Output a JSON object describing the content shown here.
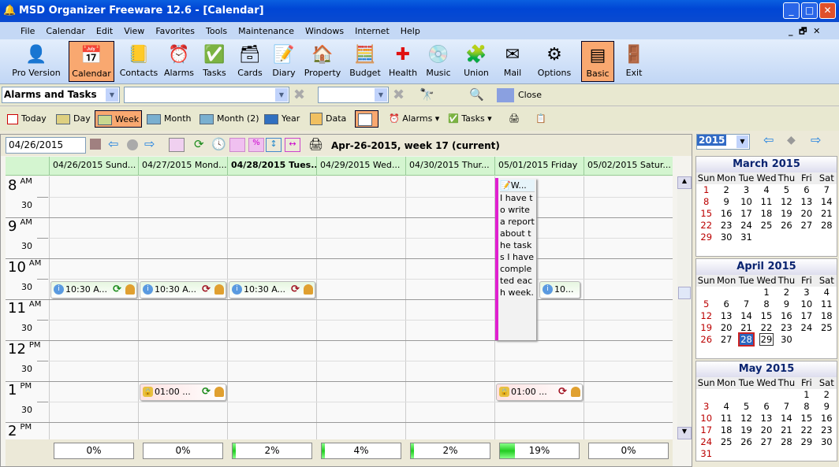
{
  "window": {
    "title": "MSD Organizer Freeware 12.6 - [Calendar]"
  },
  "menu": [
    "File",
    "Calendar",
    "Edit",
    "View",
    "Favorites",
    "Tools",
    "Maintenance",
    "Windows",
    "Internet",
    "Help"
  ],
  "toolbar": [
    {
      "label": "Pro Version",
      "icon": "pro-icon",
      "glyph": "👤",
      "active": false
    },
    {
      "label": "Calendar",
      "icon": "calendar-icon",
      "glyph": "📅",
      "active": true
    },
    {
      "label": "Contacts",
      "icon": "contacts-icon",
      "glyph": "📒",
      "active": false
    },
    {
      "label": "Alarms",
      "icon": "alarm-clock-icon",
      "glyph": "⏰",
      "active": false
    },
    {
      "label": "Tasks",
      "icon": "tasks-icon",
      "glyph": "✅",
      "active": false
    },
    {
      "label": "Cards",
      "icon": "cards-icon",
      "glyph": "🗃",
      "active": false
    },
    {
      "label": "Diary",
      "icon": "diary-icon",
      "glyph": "📝",
      "active": false
    },
    {
      "label": "Property",
      "icon": "house-icon",
      "glyph": "🏠",
      "active": false
    },
    {
      "label": "Budget",
      "icon": "calculator-icon",
      "glyph": "🧮",
      "active": false
    },
    {
      "label": "Health",
      "icon": "health-cross-icon",
      "glyph": "✚",
      "active": false
    },
    {
      "label": "Music",
      "icon": "music-cd-icon",
      "glyph": "💿",
      "active": false
    },
    {
      "label": "Union",
      "icon": "puzzle-icon",
      "glyph": "🧩",
      "active": false
    },
    {
      "label": "Mail",
      "icon": "envelope-icon",
      "glyph": "✉",
      "active": false
    },
    {
      "label": "Options",
      "icon": "gear-icon",
      "glyph": "⚙",
      "active": false
    },
    {
      "label": "Basic",
      "icon": "basic-layout-icon",
      "glyph": "▤",
      "active": true
    },
    {
      "label": "Exit",
      "icon": "exit-door-icon",
      "glyph": "🚪",
      "active": false
    }
  ],
  "filter": {
    "type_value": "Alarms and Tasks",
    "close_label": "Close"
  },
  "views": {
    "today": "Today",
    "day": "Day",
    "week": "Week",
    "month": "Month",
    "month2": "Month (2)",
    "year": "Year",
    "data": "Data",
    "alarms": "Alarms",
    "tasks": "Tasks",
    "active": "Week"
  },
  "datebar": {
    "date": "04/26/2015",
    "caption": "Apr-26-2015, week 17 (current)"
  },
  "days": [
    {
      "label": "04/26/2015 Sund...",
      "bold": false,
      "progress": 0,
      "progress_label": "0%"
    },
    {
      "label": "04/27/2015 Mond...",
      "bold": false,
      "progress": 0,
      "progress_label": "0%"
    },
    {
      "label": "04/28/2015 Tues...",
      "bold": true,
      "progress": 2,
      "progress_label": "2%"
    },
    {
      "label": "04/29/2015 Wed...",
      "bold": false,
      "progress": 4,
      "progress_label": "4%"
    },
    {
      "label": "04/30/2015 Thur...",
      "bold": false,
      "progress": 2,
      "progress_label": "2%"
    },
    {
      "label": "05/01/2015 Friday",
      "bold": false,
      "progress": 19,
      "progress_label": "19%"
    },
    {
      "label": "05/02/2015 Satur...",
      "bold": false,
      "progress": 0,
      "progress_label": "0%"
    }
  ],
  "hours": [
    {
      "h": "8",
      "ap": "AM"
    },
    {
      "h": "9",
      "ap": "AM"
    },
    {
      "h": "10",
      "ap": "AM"
    },
    {
      "h": "11",
      "ap": "AM"
    },
    {
      "h": "12",
      "ap": "PM"
    },
    {
      "h": "1",
      "ap": "PM"
    },
    {
      "h": "2",
      "ap": "PM"
    }
  ],
  "half_label": "30",
  "events": [
    {
      "day": 0,
      "time": "10:30",
      "label": "10:30 A...",
      "kind": "info",
      "repeat_color": "#1a8a1a"
    },
    {
      "day": 1,
      "time": "10:30",
      "label": "10:30 A...",
      "kind": "info",
      "repeat_color": "#a01020"
    },
    {
      "day": 2,
      "time": "10:30",
      "label": "10:30 A...",
      "kind": "info",
      "repeat_color": "#a01020"
    },
    {
      "day": 3,
      "time": "10:30",
      "label": "10...",
      "kind": "info",
      "repeat_color": null
    },
    {
      "day": 1,
      "time": "13:00",
      "label": "01:00 ...",
      "kind": "lock",
      "repeat_color": "#1a8a1a"
    },
    {
      "day": 5,
      "time": "13:00",
      "label": "01:00 ...",
      "kind": "lock",
      "repeat_color": "#a01020"
    }
  ],
  "note": {
    "title": "W...",
    "text": "I have to write a report about the tasks I have completed each week.",
    "color": "#e020d0"
  },
  "mini": {
    "year": "2015",
    "weekdays": [
      "Sun",
      "Mon",
      "Tue",
      "Wed",
      "Thu",
      "Fri",
      "Sat"
    ],
    "months": [
      {
        "title": "March 2015",
        "offset": 0,
        "days": 31
      },
      {
        "title": "April 2015",
        "offset": 3,
        "days": 30,
        "today": 28,
        "selected": 29
      },
      {
        "title": "May 2015",
        "offset": 5,
        "days": 31
      }
    ]
  }
}
